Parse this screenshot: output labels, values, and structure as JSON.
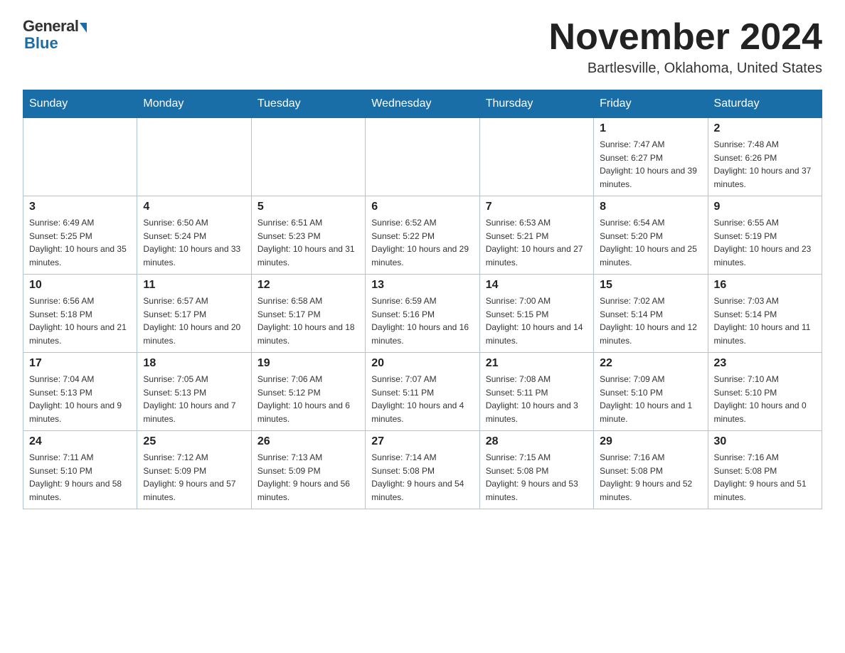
{
  "header": {
    "logo_general": "General",
    "logo_blue": "Blue",
    "month_title": "November 2024",
    "location": "Bartlesville, Oklahoma, United States"
  },
  "weekdays": [
    "Sunday",
    "Monday",
    "Tuesday",
    "Wednesday",
    "Thursday",
    "Friday",
    "Saturday"
  ],
  "weeks": [
    [
      {
        "day": "",
        "sunrise": "",
        "sunset": "",
        "daylight": ""
      },
      {
        "day": "",
        "sunrise": "",
        "sunset": "",
        "daylight": ""
      },
      {
        "day": "",
        "sunrise": "",
        "sunset": "",
        "daylight": ""
      },
      {
        "day": "",
        "sunrise": "",
        "sunset": "",
        "daylight": ""
      },
      {
        "day": "",
        "sunrise": "",
        "sunset": "",
        "daylight": ""
      },
      {
        "day": "1",
        "sunrise": "Sunrise: 7:47 AM",
        "sunset": "Sunset: 6:27 PM",
        "daylight": "Daylight: 10 hours and 39 minutes."
      },
      {
        "day": "2",
        "sunrise": "Sunrise: 7:48 AM",
        "sunset": "Sunset: 6:26 PM",
        "daylight": "Daylight: 10 hours and 37 minutes."
      }
    ],
    [
      {
        "day": "3",
        "sunrise": "Sunrise: 6:49 AM",
        "sunset": "Sunset: 5:25 PM",
        "daylight": "Daylight: 10 hours and 35 minutes."
      },
      {
        "day": "4",
        "sunrise": "Sunrise: 6:50 AM",
        "sunset": "Sunset: 5:24 PM",
        "daylight": "Daylight: 10 hours and 33 minutes."
      },
      {
        "day": "5",
        "sunrise": "Sunrise: 6:51 AM",
        "sunset": "Sunset: 5:23 PM",
        "daylight": "Daylight: 10 hours and 31 minutes."
      },
      {
        "day": "6",
        "sunrise": "Sunrise: 6:52 AM",
        "sunset": "Sunset: 5:22 PM",
        "daylight": "Daylight: 10 hours and 29 minutes."
      },
      {
        "day": "7",
        "sunrise": "Sunrise: 6:53 AM",
        "sunset": "Sunset: 5:21 PM",
        "daylight": "Daylight: 10 hours and 27 minutes."
      },
      {
        "day": "8",
        "sunrise": "Sunrise: 6:54 AM",
        "sunset": "Sunset: 5:20 PM",
        "daylight": "Daylight: 10 hours and 25 minutes."
      },
      {
        "day": "9",
        "sunrise": "Sunrise: 6:55 AM",
        "sunset": "Sunset: 5:19 PM",
        "daylight": "Daylight: 10 hours and 23 minutes."
      }
    ],
    [
      {
        "day": "10",
        "sunrise": "Sunrise: 6:56 AM",
        "sunset": "Sunset: 5:18 PM",
        "daylight": "Daylight: 10 hours and 21 minutes."
      },
      {
        "day": "11",
        "sunrise": "Sunrise: 6:57 AM",
        "sunset": "Sunset: 5:17 PM",
        "daylight": "Daylight: 10 hours and 20 minutes."
      },
      {
        "day": "12",
        "sunrise": "Sunrise: 6:58 AM",
        "sunset": "Sunset: 5:17 PM",
        "daylight": "Daylight: 10 hours and 18 minutes."
      },
      {
        "day": "13",
        "sunrise": "Sunrise: 6:59 AM",
        "sunset": "Sunset: 5:16 PM",
        "daylight": "Daylight: 10 hours and 16 minutes."
      },
      {
        "day": "14",
        "sunrise": "Sunrise: 7:00 AM",
        "sunset": "Sunset: 5:15 PM",
        "daylight": "Daylight: 10 hours and 14 minutes."
      },
      {
        "day": "15",
        "sunrise": "Sunrise: 7:02 AM",
        "sunset": "Sunset: 5:14 PM",
        "daylight": "Daylight: 10 hours and 12 minutes."
      },
      {
        "day": "16",
        "sunrise": "Sunrise: 7:03 AM",
        "sunset": "Sunset: 5:14 PM",
        "daylight": "Daylight: 10 hours and 11 minutes."
      }
    ],
    [
      {
        "day": "17",
        "sunrise": "Sunrise: 7:04 AM",
        "sunset": "Sunset: 5:13 PM",
        "daylight": "Daylight: 10 hours and 9 minutes."
      },
      {
        "day": "18",
        "sunrise": "Sunrise: 7:05 AM",
        "sunset": "Sunset: 5:13 PM",
        "daylight": "Daylight: 10 hours and 7 minutes."
      },
      {
        "day": "19",
        "sunrise": "Sunrise: 7:06 AM",
        "sunset": "Sunset: 5:12 PM",
        "daylight": "Daylight: 10 hours and 6 minutes."
      },
      {
        "day": "20",
        "sunrise": "Sunrise: 7:07 AM",
        "sunset": "Sunset: 5:11 PM",
        "daylight": "Daylight: 10 hours and 4 minutes."
      },
      {
        "day": "21",
        "sunrise": "Sunrise: 7:08 AM",
        "sunset": "Sunset: 5:11 PM",
        "daylight": "Daylight: 10 hours and 3 minutes."
      },
      {
        "day": "22",
        "sunrise": "Sunrise: 7:09 AM",
        "sunset": "Sunset: 5:10 PM",
        "daylight": "Daylight: 10 hours and 1 minute."
      },
      {
        "day": "23",
        "sunrise": "Sunrise: 7:10 AM",
        "sunset": "Sunset: 5:10 PM",
        "daylight": "Daylight: 10 hours and 0 minutes."
      }
    ],
    [
      {
        "day": "24",
        "sunrise": "Sunrise: 7:11 AM",
        "sunset": "Sunset: 5:10 PM",
        "daylight": "Daylight: 9 hours and 58 minutes."
      },
      {
        "day": "25",
        "sunrise": "Sunrise: 7:12 AM",
        "sunset": "Sunset: 5:09 PM",
        "daylight": "Daylight: 9 hours and 57 minutes."
      },
      {
        "day": "26",
        "sunrise": "Sunrise: 7:13 AM",
        "sunset": "Sunset: 5:09 PM",
        "daylight": "Daylight: 9 hours and 56 minutes."
      },
      {
        "day": "27",
        "sunrise": "Sunrise: 7:14 AM",
        "sunset": "Sunset: 5:08 PM",
        "daylight": "Daylight: 9 hours and 54 minutes."
      },
      {
        "day": "28",
        "sunrise": "Sunrise: 7:15 AM",
        "sunset": "Sunset: 5:08 PM",
        "daylight": "Daylight: 9 hours and 53 minutes."
      },
      {
        "day": "29",
        "sunrise": "Sunrise: 7:16 AM",
        "sunset": "Sunset: 5:08 PM",
        "daylight": "Daylight: 9 hours and 52 minutes."
      },
      {
        "day": "30",
        "sunrise": "Sunrise: 7:16 AM",
        "sunset": "Sunset: 5:08 PM",
        "daylight": "Daylight: 9 hours and 51 minutes."
      }
    ]
  ]
}
